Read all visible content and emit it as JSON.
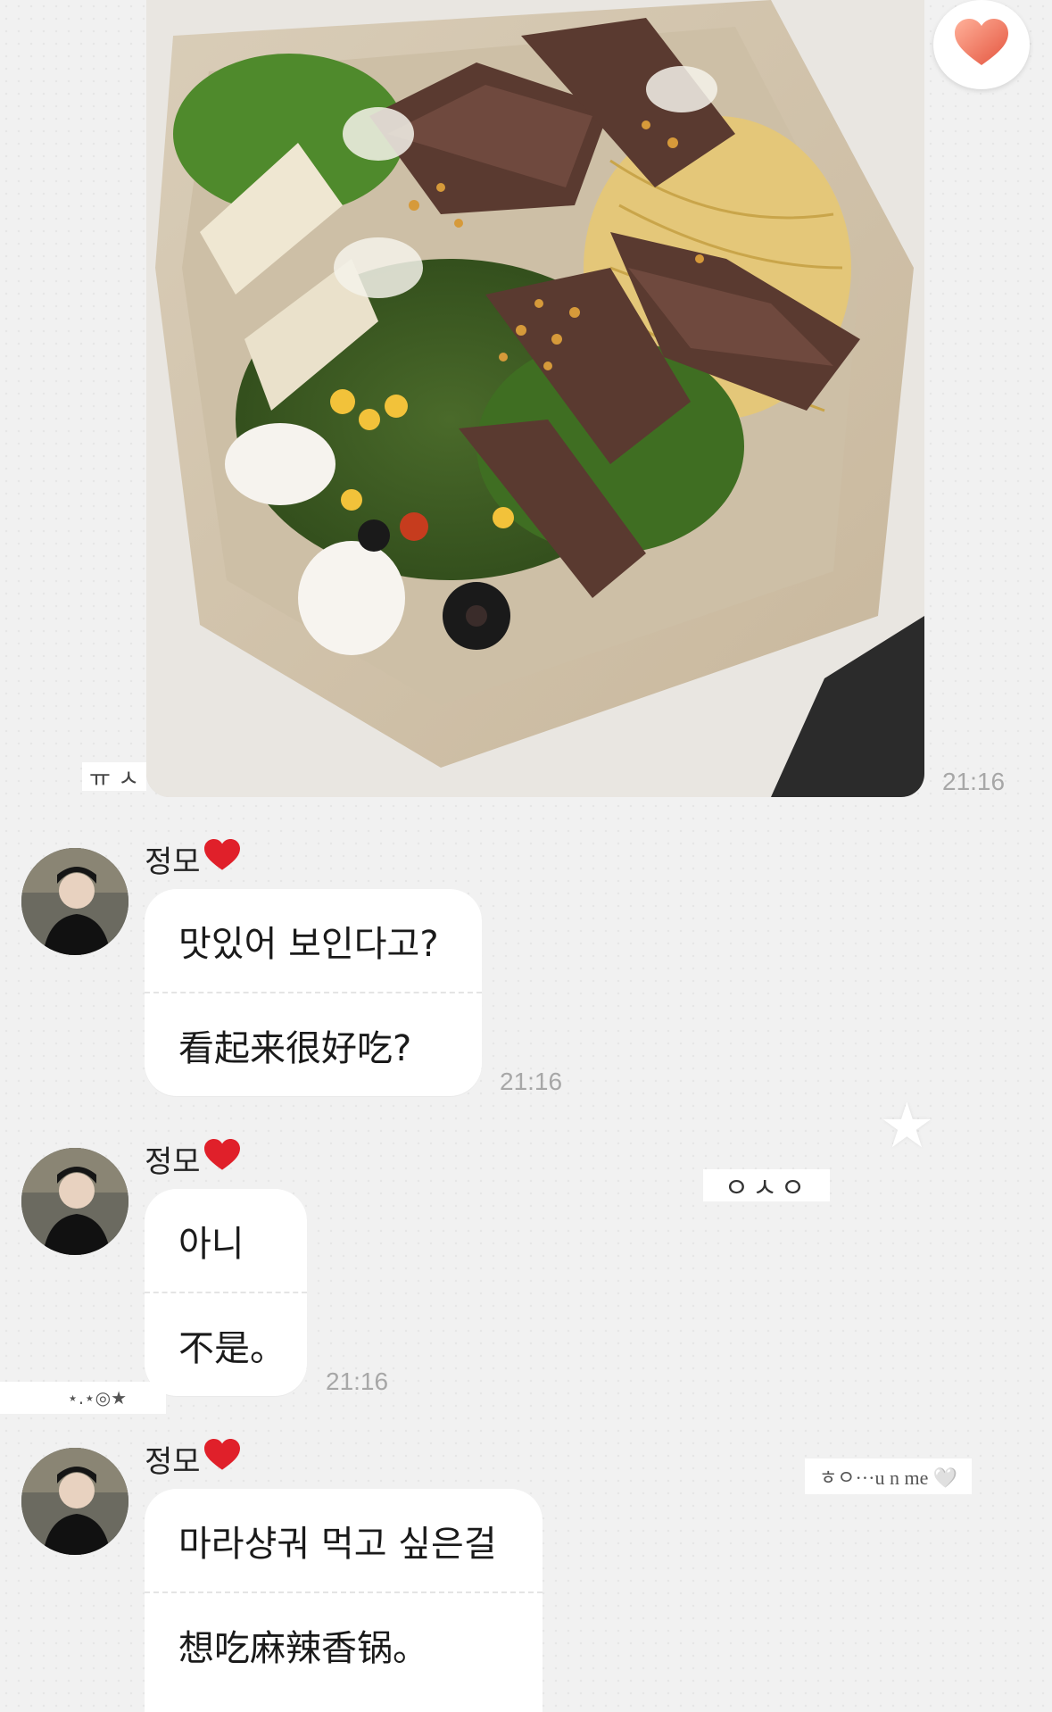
{
  "photo_message": {
    "timestamp": "21:16",
    "partial_label": "ㅠ ㅅ"
  },
  "reaction_icon": "heart-icon",
  "messages": [
    {
      "sender": "정모",
      "sender_badge_icon": "red-heart-icon",
      "lines": [
        "맛있어 보인다고?",
        "看起来很好吃?"
      ],
      "timestamp": "21:16"
    },
    {
      "sender": "정모",
      "sender_badge_icon": "red-heart-icon",
      "lines": [
        "아니",
        "不是。"
      ],
      "timestamp": "21:16"
    },
    {
      "sender": "정모",
      "sender_badge_icon": "red-heart-icon",
      "lines": [
        "마라샹궈 먹고 싶은걸",
        "想吃麻辣香锅。"
      ]
    }
  ],
  "stickers": {
    "oso": "ㅇㅅㅇ",
    "deco_left": "⋆.⋆◎★",
    "hear_me": "ㅎㅇ···u n me 🤍"
  },
  "colors": {
    "background": "#f1f1f1",
    "bubble": "#ffffff",
    "timestamp": "#a7a7a7",
    "heart": "#e0202a"
  }
}
